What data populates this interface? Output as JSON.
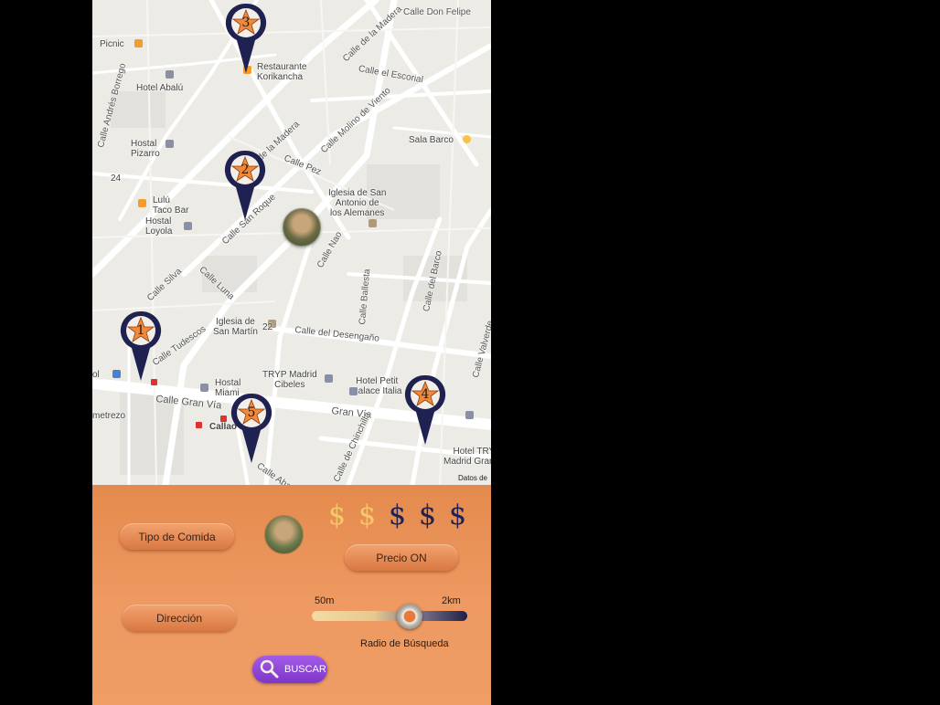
{
  "map": {
    "credit": "Datos de",
    "streets": [
      "Calle Don Felipe",
      "Calle de la Madera",
      "Calle el Escorial",
      "Calle Molino de Viento",
      "Calle Andrés Borrego",
      "Calle de la Madera",
      "Calle Pez",
      "Calle San Roque",
      "Calle Silva",
      "Calle Luna",
      "Calle Nao",
      "Calle Ballesta",
      "Calle del Barco",
      "Calle del Desengaño",
      "Calle Gran Vía",
      "Gran Vía",
      "Calle de Chinchilla",
      "Calle Abada",
      "Calle Valverde",
      "Calle Tudescos"
    ],
    "places": {
      "picnic": "Picnic",
      "restaurante": "Restaurante\nKorikancha",
      "hotel_abalu": "Hotel Abalú",
      "hostal_pizarro": "Hostal\nPizarro",
      "sala_barco": "Sala Barco",
      "lulu": "Lulú\nTaco Bar",
      "hostal_loyola": "Hostal\nLoyola",
      "iglesia_antonio": "Iglesia de San\nAntonio de\nlos Alemanes",
      "iglesia_martin": "Iglesia de\nSan Martín",
      "hostal_miami": "Hostal\nMiami",
      "tryp_cibeles": "TRYP Madrid\nCibeles",
      "hotel_petit": "Hotel Petit\nPalace Italia",
      "hotel_tryp_gv": "Hotel TRYP\nMadrid Gran Vía",
      "callao": "Callao",
      "num_22": "22",
      "num_24": "24",
      "nmetrezo": "metrezo",
      "nol": "ol"
    },
    "pins": [
      {
        "number": "1"
      },
      {
        "number": "2"
      },
      {
        "number": "3"
      },
      {
        "number": "4"
      },
      {
        "number": "5"
      }
    ]
  },
  "panel": {
    "tipo_comida_label": "Tipo de Comida",
    "direccion_label": "Dirección",
    "precio_label": "Precio ON",
    "price_symbols": [
      "$",
      "$",
      "$",
      "$",
      "$"
    ],
    "price_level": 2,
    "price_active_color": "#f5c869",
    "price_inactive_color": "#1f2150",
    "radius_min": "50m",
    "radius_max": "2km",
    "radius_label": "Radio de Búsqueda",
    "radius_fraction": 0.63,
    "search_label": "BUSCAR",
    "search_icon": "search-icon"
  }
}
